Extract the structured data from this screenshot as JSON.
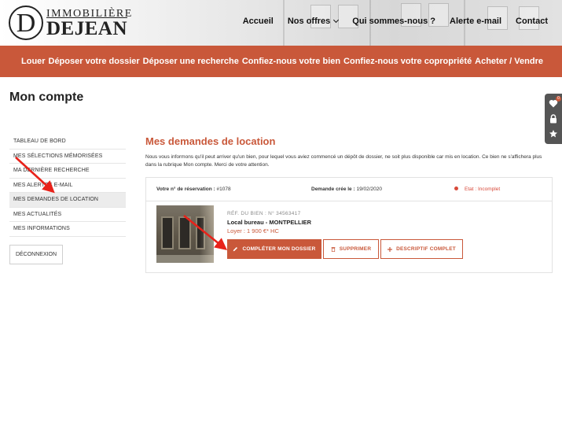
{
  "brand": {
    "logo_letter": "D",
    "logo_top": "IMMOBILIÈRE",
    "logo_bottom": "DEJEAN"
  },
  "topnav": {
    "items": [
      "Accueil",
      "Nos offres",
      "Qui sommes-nous ?",
      "Alerte e-mail",
      "Contact"
    ]
  },
  "mainnav": {
    "items": [
      "Louer",
      "Déposer votre dossier",
      "Déposer une recherche",
      "Confiez-nous votre bien",
      "Confiez-nous votre copropriété",
      "Acheter / Vendre"
    ]
  },
  "page": {
    "title": "Mon compte"
  },
  "sidetools": {
    "favorites_count": "0",
    "icons": [
      "heart-icon",
      "lock-icon",
      "star-icon"
    ]
  },
  "sidebar": {
    "items": [
      "TABLEAU DE BORD",
      "MES SÉLECTIONS MÉMORISÉES",
      "MA DERNIÈRE RECHERCHE",
      "MES ALERTES E-MAIL",
      "MES DEMANDES DE LOCATION",
      "MES ACTUALITÉS",
      "MES INFORMATIONS"
    ],
    "active_index": 4,
    "logout_label": "DÉCONNEXION"
  },
  "content": {
    "section_title": "Mes demandes de location",
    "intro": "Nous vous informons qu'il peut arriver qu'un bien, pour lequel vous aviez commencé un dépôt de dossier, ne soit plus disponible car mis en location. Ce bien ne s'affichera plus dans la rubrique Mon compte. Merci de votre attention.",
    "request": {
      "reservation_label": "Votre n° de réservation :",
      "reservation_value": "#1078",
      "created_label": "Demande crée le :",
      "created_value": "19/02/2020",
      "status_label": "Etat : Incomplet",
      "ref": "RÉF. DU BIEN : N° 34563417",
      "property_title": "Local bureau - MONTPELLIER",
      "rent": "Loyer : 1 900 €* HC",
      "complete_label": "COMPLÉTER MON DOSSIER",
      "delete_label": "SUPPRIMER",
      "description_label": "DESCRIPTIF COMPLET"
    }
  },
  "colors": {
    "accent": "#c9583a",
    "status": "#d84a3a",
    "arrow": "#e8221a",
    "toolbar": "#555555"
  }
}
